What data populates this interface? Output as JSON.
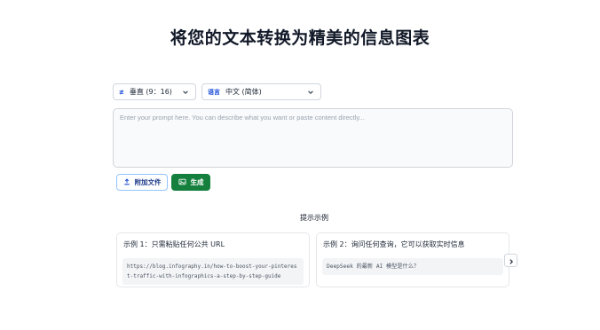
{
  "header": {
    "title": "将您的文本转换为精美的信息图表"
  },
  "controls": {
    "orientation": {
      "tag_icon": "layout-icon",
      "tag": "≢",
      "value": "垂直 (9：16)"
    },
    "language": {
      "tag": "语言",
      "value": "中文 (简体)"
    }
  },
  "prompt": {
    "placeholder": "Enter your prompt here. You can describe what you want or paste content directly..."
  },
  "actions": {
    "attach_label": "附加文件",
    "generate_label": "生成"
  },
  "examples": {
    "section_label": "提示示例",
    "cards": [
      {
        "title": "示例 1：只需粘贴任何公共 URL",
        "body": "https://blog.infography.in/how-to-boost-your-pinterest-traffic-with-infographics-a-step-by-step-guide"
      },
      {
        "title": "示例 2：询问任何查询，它可以获取实时信息",
        "body": "DeepSeek 的最新 AI 模型是什么？"
      }
    ]
  },
  "colors": {
    "accent": "#15803d",
    "tag_blue": "#1d4ed8"
  }
}
